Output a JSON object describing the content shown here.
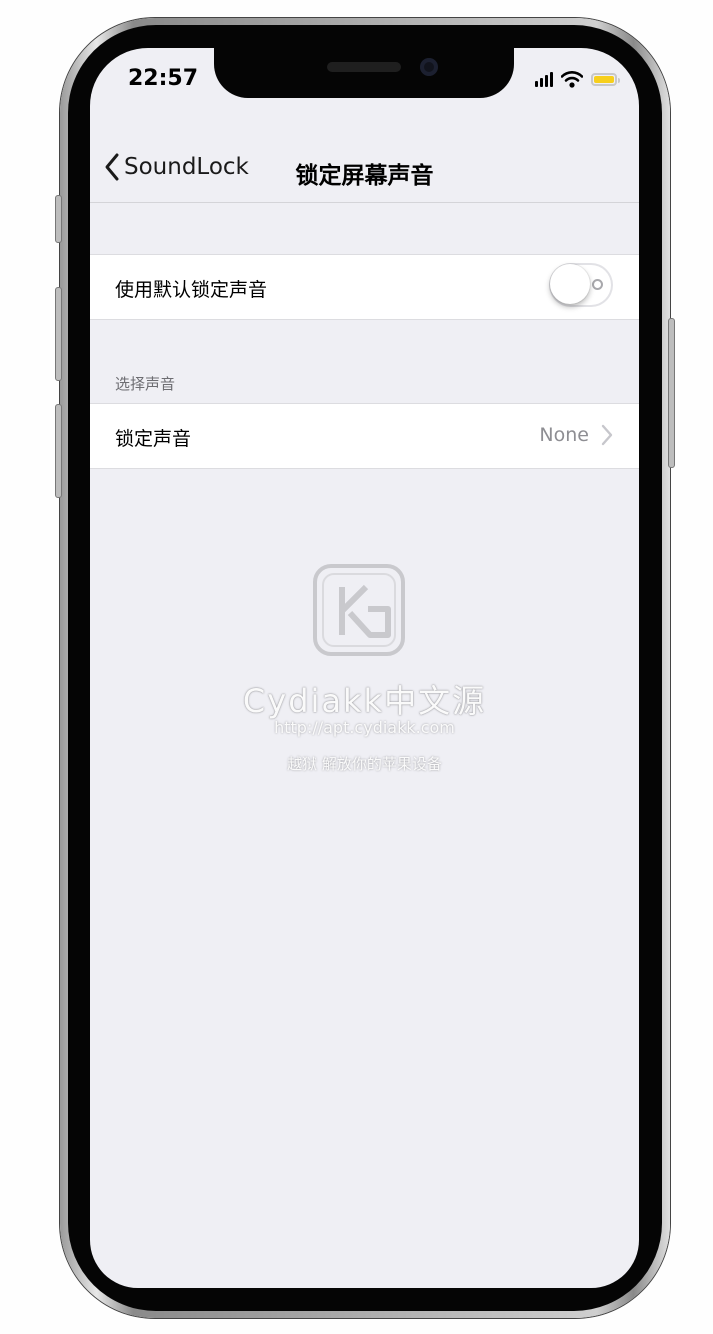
{
  "status_bar": {
    "time": "22:57",
    "icons": [
      "cellular-signal-icon",
      "wifi-icon",
      "battery-icon"
    ],
    "battery_color": "#f7cf1c"
  },
  "nav": {
    "back_label": "SoundLock",
    "title": "锁定屏幕声音"
  },
  "settings": {
    "default_sound": {
      "label": "使用默认锁定声音",
      "toggle_on": false
    },
    "section_header": "选择声音",
    "lock_sound": {
      "label": "锁定声音",
      "value": "None"
    }
  },
  "watermark": {
    "brand": "Cydiakk中文源",
    "url": "http://apt.cydiakk.com",
    "slogan": "越狱 解放你的苹果设备"
  },
  "colors": {
    "background": "#efeff4",
    "cell": "#ffffff",
    "secondary_text": "#8e8e93",
    "section_text": "#6d6d72"
  }
}
